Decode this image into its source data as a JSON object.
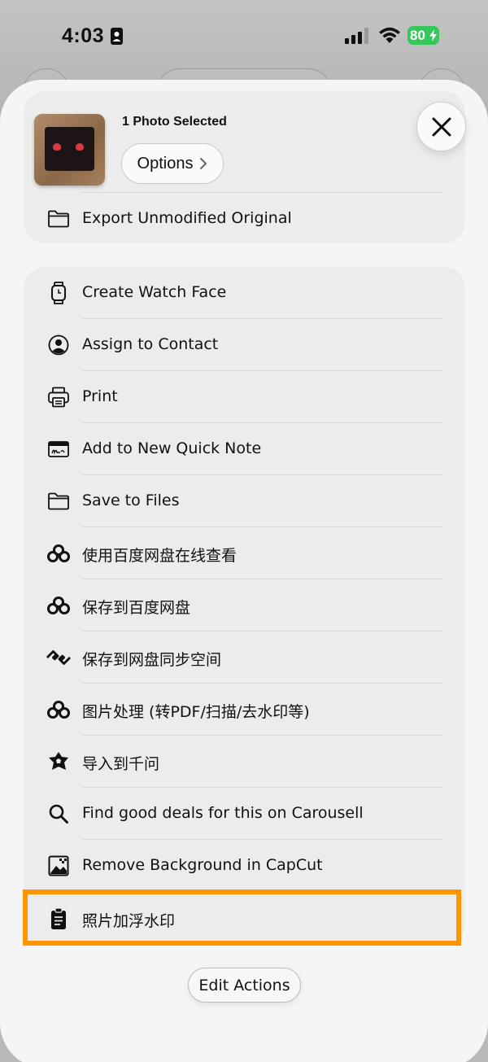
{
  "status_bar": {
    "time": "4:03",
    "battery": "80"
  },
  "header": {
    "selection_text": "1 Photo Selected",
    "options_label": "Options"
  },
  "top_actions": [
    {
      "label": "Export Unmodified Original",
      "icon": "folder-icon"
    }
  ],
  "actions": [
    {
      "label": "Create Watch Face",
      "icon": "watch-icon"
    },
    {
      "label": "Assign to Contact",
      "icon": "contact-icon"
    },
    {
      "label": "Print",
      "icon": "printer-icon"
    },
    {
      "label": "Add to New Quick Note",
      "icon": "quick-note-icon"
    },
    {
      "label": "Save to Files",
      "icon": "folder-icon"
    },
    {
      "label": "使用百度网盘在线查看",
      "icon": "baidu-netdisk-icon"
    },
    {
      "label": "保存到百度网盘",
      "icon": "baidu-netdisk-icon"
    },
    {
      "label": "保存到网盘同步空间",
      "icon": "sync-space-icon"
    },
    {
      "label": "图片处理 (转PDF/扫描/去水印等)",
      "icon": "baidu-netdisk-icon"
    },
    {
      "label": "导入到千问",
      "icon": "qianwen-icon"
    },
    {
      "label": "Find good deals for this on Carousell",
      "icon": "search-icon"
    },
    {
      "label": "Remove Background in CapCut",
      "icon": "image-icon"
    },
    {
      "label": "照片加浮水印",
      "icon": "clipboard-icon"
    }
  ],
  "edit_actions_label": "Edit Actions",
  "colors": {
    "highlight": "#ff9500",
    "battery": "#34c759"
  }
}
